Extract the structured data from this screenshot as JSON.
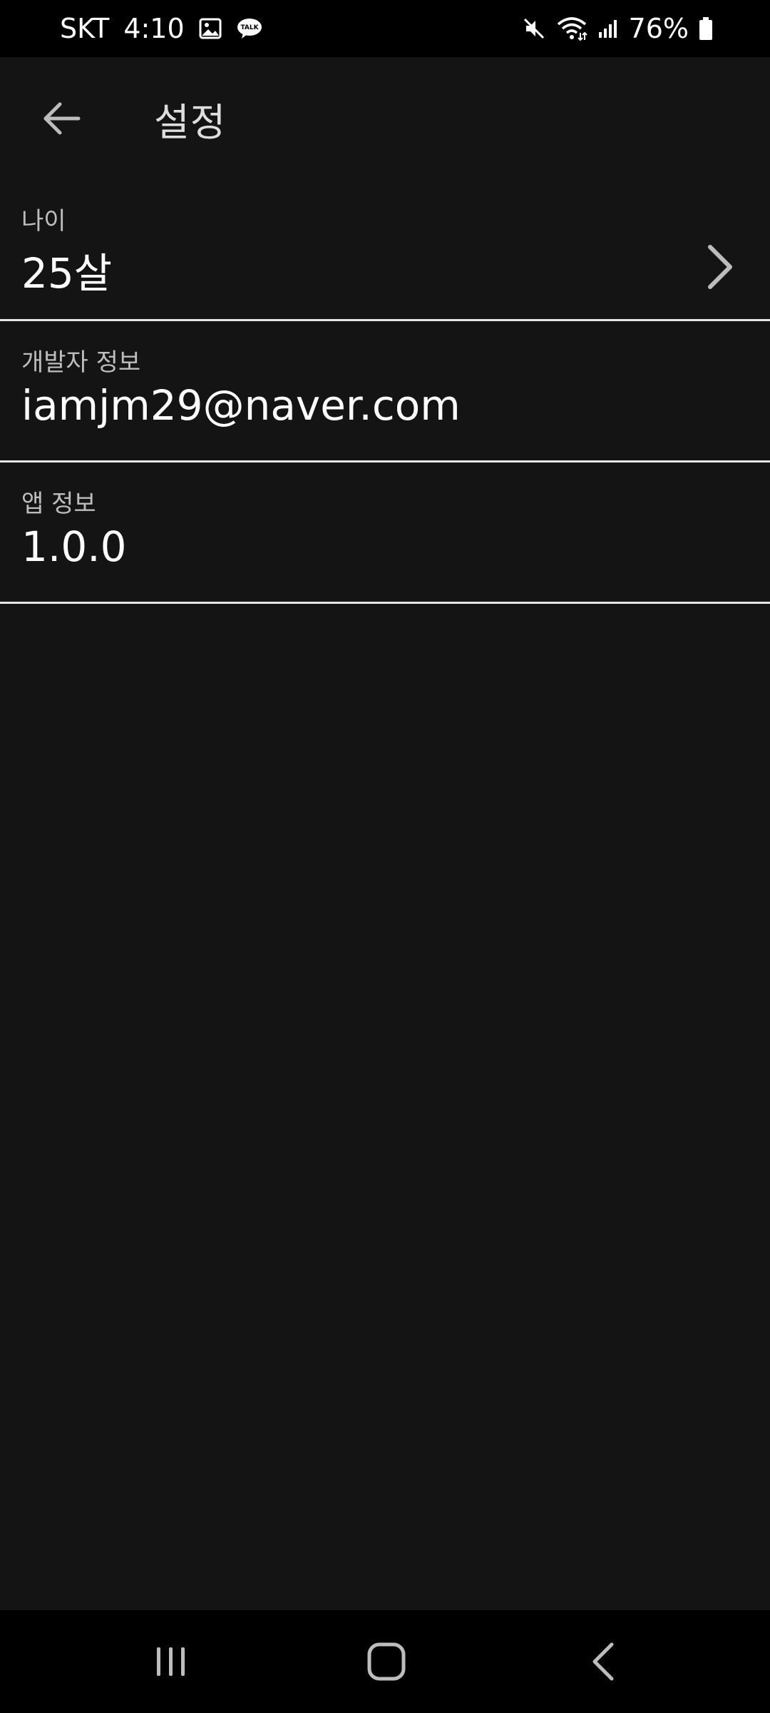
{
  "status_bar": {
    "carrier": "SKT",
    "time": "4:10",
    "notification_icons": [
      "gallery-icon",
      "kakaotalk-icon"
    ],
    "kakaotalk_badge": "TALK",
    "system_icons": [
      "mute-icon",
      "wifi-icon",
      "signal-icon",
      "battery-icon"
    ],
    "battery": "76%"
  },
  "app_bar": {
    "title": "설정",
    "back_icon": "arrow-left-icon"
  },
  "settings": [
    {
      "label": "나이",
      "value": "25살",
      "has_chevron": true
    },
    {
      "label": "개발자 정보",
      "value": "iamjm29@naver.com",
      "has_chevron": false
    },
    {
      "label": "앱 정보",
      "value": "1.0.0",
      "has_chevron": false
    }
  ],
  "nav_bar": {
    "buttons": [
      "recent-apps-icon",
      "home-icon",
      "back-icon"
    ]
  },
  "colors": {
    "background": "#141414",
    "status_bar": "#000000",
    "divider": "#e6e6e6",
    "label": "#bdbdbd",
    "value": "#ffffff"
  }
}
